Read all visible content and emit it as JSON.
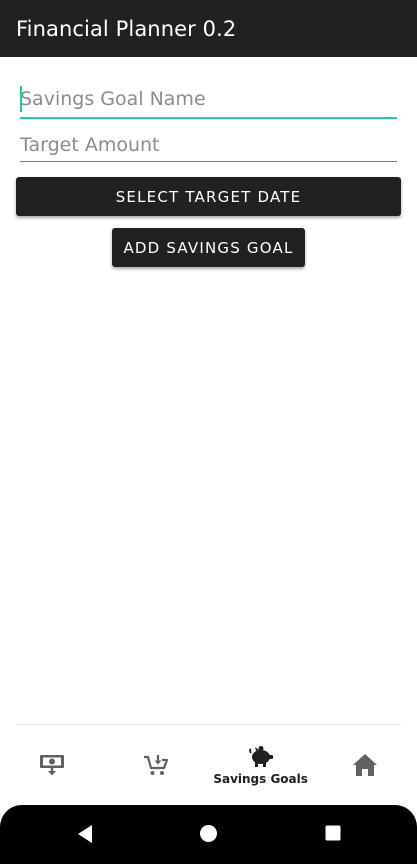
{
  "app": {
    "title": "Financial Planner 0.2"
  },
  "form": {
    "goal_name": {
      "value": "",
      "placeholder": "Savings Goal Name"
    },
    "target_amount": {
      "value": "",
      "placeholder": "Target Amount"
    },
    "select_date_label": "SELECT TARGET DATE",
    "add_goal_label": "ADD SAVINGS GOAL"
  },
  "bottom_nav": {
    "items": [
      {
        "icon": "money-icon",
        "label": ""
      },
      {
        "icon": "cart-icon",
        "label": ""
      },
      {
        "icon": "piggy-bank-icon",
        "label": "Savings Goals",
        "active": true
      },
      {
        "icon": "home-icon",
        "label": ""
      }
    ]
  },
  "system_nav": {
    "icons": [
      "back-icon",
      "home-circle-icon",
      "recents-icon"
    ]
  },
  "colors": {
    "appbar": "#212121",
    "accent": "#26c6b0",
    "button": "#212121"
  }
}
